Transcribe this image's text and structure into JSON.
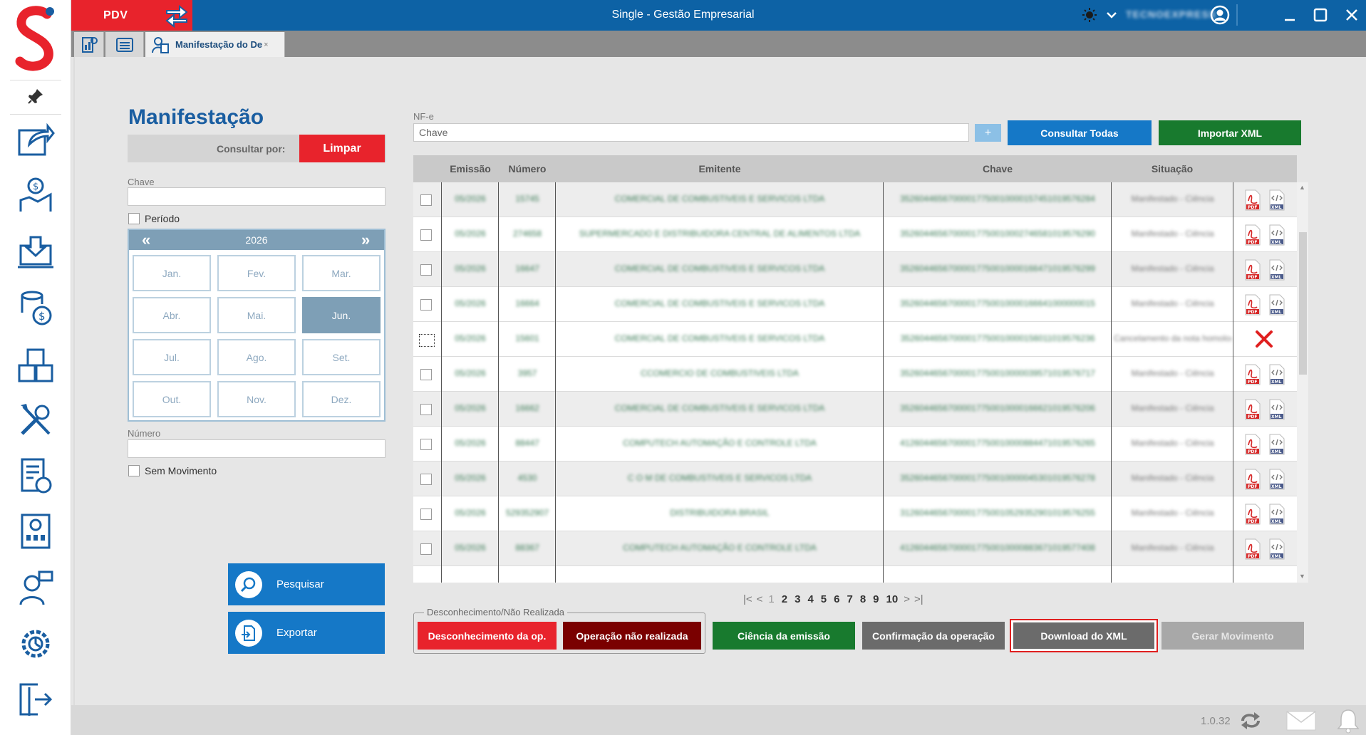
{
  "window": {
    "title": "Single - Gestão Empresarial",
    "pdv_label": "PDV",
    "user_name": "TECNOEXPRESS"
  },
  "tabs": [
    {
      "label": "",
      "icon": "dashboard-icon"
    },
    {
      "label": "",
      "icon": "list-icon"
    },
    {
      "label": "Manifestação do De",
      "icon": "manifest-icon",
      "close": "×"
    }
  ],
  "sidebar": {
    "items": [
      "export-icon",
      "finance-icon",
      "download-icon",
      "coins-icon",
      "boxes-icon",
      "tools-icon",
      "invoice-icon",
      "report-icon",
      "support-icon",
      "settings-icon",
      "exit-icon"
    ]
  },
  "left_panel": {
    "title": "Manifestação",
    "consult_label": "Consultar por:",
    "clear_button": "Limpar",
    "chave_label": "Chave",
    "chave_value": "",
    "periodo_label": "Período",
    "calendar": {
      "prev": "«",
      "next": "»",
      "year": "2026",
      "months": [
        "Jan.",
        "Fev.",
        "Mar.",
        "Abr.",
        "Mai.",
        "Jun.",
        "Jul.",
        "Ago.",
        "Set.",
        "Out.",
        "Nov.",
        "Dez."
      ],
      "selected": "Jun."
    },
    "numero_label": "Número",
    "numero_value": "",
    "sem_movimento_label": "Sem Movimento",
    "search_button": "Pesquisar",
    "export_button": "Exportar"
  },
  "right_panel": {
    "nfe_label": "NF-e",
    "chave_placeholder": "Chave",
    "plus": "+",
    "consultar_todas": "Consultar Todas",
    "importar_xml": "Importar XML",
    "columns": [
      "Emissão",
      "Número",
      "Emitente",
      "Chave",
      "Situação"
    ],
    "rows": [
      {
        "emissao": "05/2026",
        "numero": "15745",
        "emitente": "COMERCIAL DE COMBUSTIVEIS E SERVICOS LTDA",
        "chave": "35260446567000017750010000157451019576284",
        "situacao": "Manifestado - Ciência",
        "status": "ok"
      },
      {
        "emissao": "05/2026",
        "numero": "274658",
        "emitente": "SUPERMERCADO E DISTRIBUIDORA CENTRAL DE ALIMENTOS LTDA",
        "chave": "35260446567000017750010002746581019576290",
        "situacao": "Manifestado - Ciência",
        "status": "ok"
      },
      {
        "emissao": "05/2026",
        "numero": "16647",
        "emitente": "COMERCIAL DE COMBUSTIVEIS E SERVICOS LTDA",
        "chave": "35260446567000017750010000166471019576299",
        "situacao": "Manifestado - Ciência",
        "status": "ok"
      },
      {
        "emissao": "05/2026",
        "numero": "16664",
        "emitente": "COMERCIAL DE COMBUSTIVEIS E SERVICOS LTDA",
        "chave": "35260446567000017750010000166641000000015",
        "situacao": "Manifestado - Ciência",
        "status": "ok"
      },
      {
        "emissao": "05/2026",
        "numero": "15601",
        "emitente": "COMERCIAL DE COMBUSTIVEIS E SERVICOS LTDA",
        "chave": "35260446567000017750010000156011019576236",
        "situacao": "Cancelamento da nota homologado",
        "status": "error"
      },
      {
        "emissao": "05/2026",
        "numero": "3957",
        "emitente": "CCOMERCIO DE COMBUSTIVEIS LTDA",
        "chave": "35260446567000017750010000039571019576717",
        "situacao": "Manifestado - Ciência",
        "status": "ok"
      },
      {
        "emissao": "05/2026",
        "numero": "16662",
        "emitente": "COMERCIAL DE COMBUSTIVEIS E SERVICOS LTDA",
        "chave": "35260446567000017750010000166621019576206",
        "situacao": "Manifestado - Ciência",
        "status": "ok"
      },
      {
        "emissao": "05/2026",
        "numero": "88447",
        "emitente": "COMPUTECH AUTOMAÇÃO E CONTROLE LTDA",
        "chave": "41260446567000017750010000884471019576265",
        "situacao": "Manifestado - Ciência",
        "status": "ok"
      },
      {
        "emissao": "05/2026",
        "numero": "4530",
        "emitente": "C O M DE COMBUSTIVEIS E SERVICOS LTDA",
        "chave": "35260446567000017750010000045301019576278",
        "situacao": "Manifestado - Ciência",
        "status": "ok"
      },
      {
        "emissao": "05/2026",
        "numero": "529352907",
        "emitente": "DISTRIBUIDORA BRASIL",
        "chave": "31260446567000017750010529352901019576255",
        "situacao": "Manifestado - Ciência",
        "status": "ok"
      },
      {
        "emissao": "05/2026",
        "numero": "88367",
        "emitente": "COMPUTECH AUTOMAÇÃO E CONTROLE LTDA",
        "chave": "41260446567000017750010000883671019577408",
        "situacao": "Manifestado - Ciência",
        "status": "ok"
      }
    ],
    "pager": {
      "first": "|<",
      "prev": "<",
      "pages": [
        "1",
        "2",
        "3",
        "4",
        "5",
        "6",
        "7",
        "8",
        "9",
        "10"
      ],
      "current": "1",
      "next": ">",
      "last": ">|"
    },
    "group_label": "Desconhecimento/Não Realizada",
    "buttons": {
      "desconhecimento": "Desconhecimento da op.",
      "nao_realizada": "Operação não realizada",
      "ciencia": "Ciência da emissão",
      "confirmacao": "Confirmação da operação",
      "download_xml": "Download do XML",
      "gerar_movimento": "Gerar Movimento"
    }
  },
  "footer": {
    "version": "1.0.32"
  },
  "colors": {
    "brand_blue": "#0d62a5",
    "brand_red": "#e8232c",
    "title_blue": "#1a5ea1",
    "action_blue": "#1578c7",
    "green": "#187a2e",
    "dark_red": "#7a0000",
    "gray_button": "#6b6b6b",
    "disabled_gray": "#a8a8a8",
    "highlight_red": "#e02020"
  }
}
